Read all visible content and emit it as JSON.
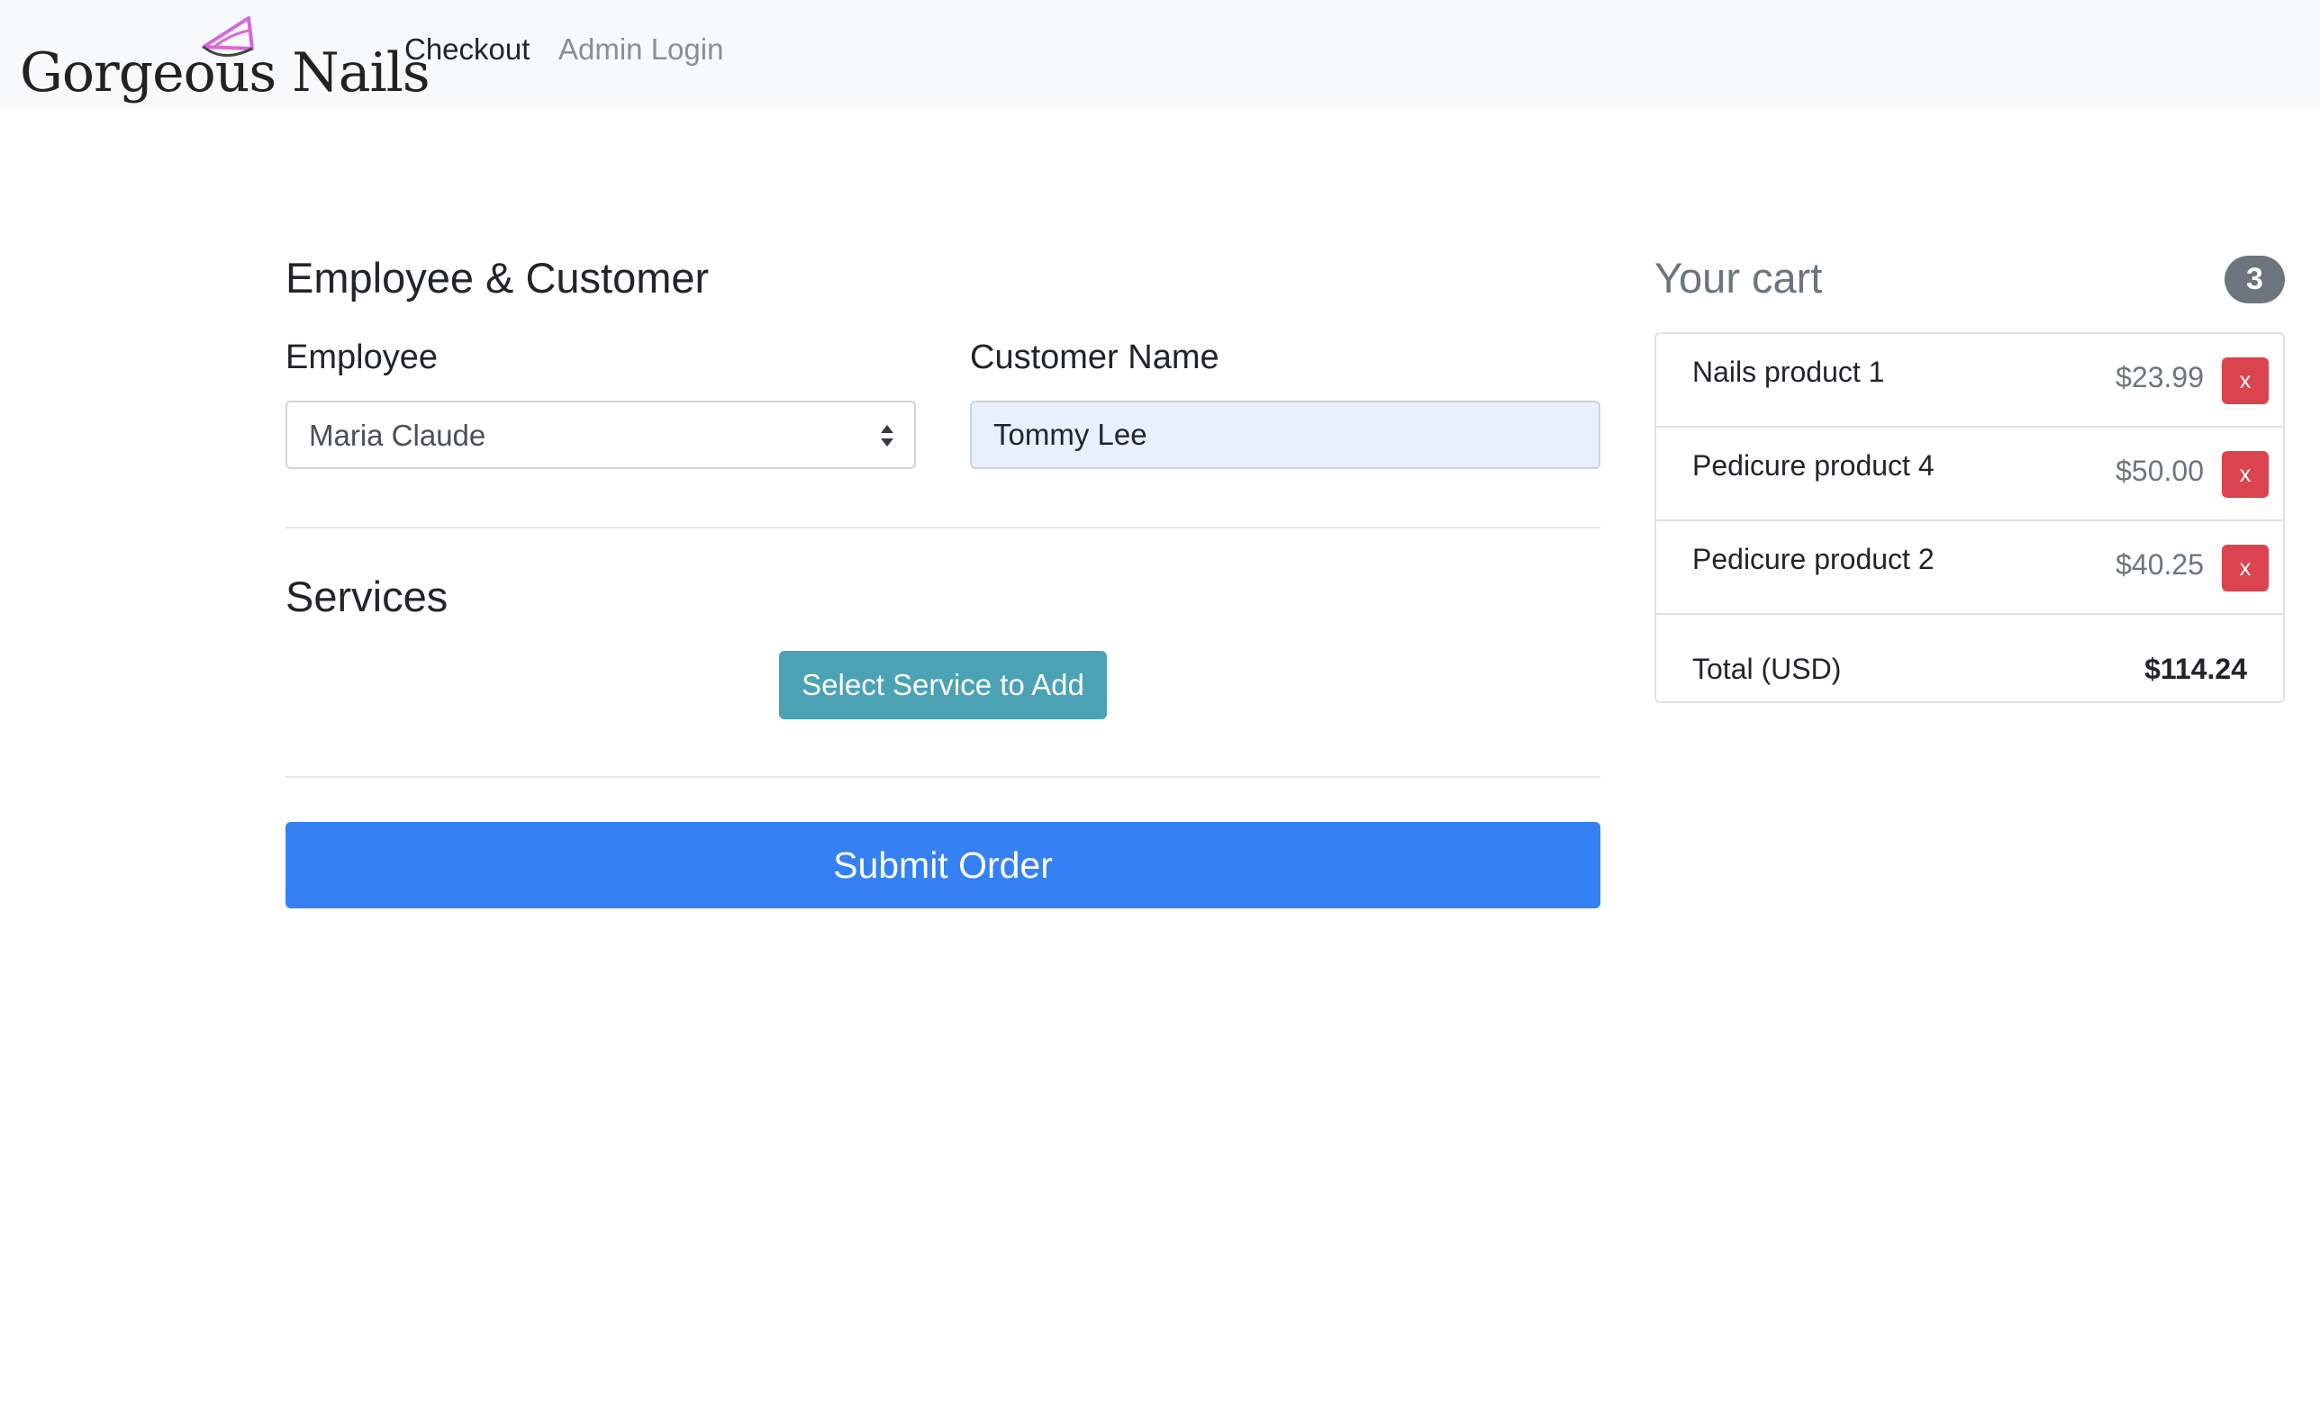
{
  "navbar": {
    "brand": "Gorgeous Nails",
    "brand_icon": "nail-polish-icon",
    "links": [
      {
        "label": "Checkout",
        "active": true
      },
      {
        "label": "Admin Login",
        "active": false
      }
    ]
  },
  "form": {
    "section_title": "Employee & Customer",
    "employee_label": "Employee",
    "employee_value": "Maria Claude",
    "customer_label": "Customer Name",
    "customer_value": "Tommy Lee",
    "services_title": "Services",
    "add_service_label": "Select Service to Add",
    "submit_label": "Submit Order"
  },
  "cart": {
    "title": "Your cart",
    "count": "3",
    "items": [
      {
        "name": "Nails product 1",
        "price": "$23.99",
        "remove_label": "x"
      },
      {
        "name": "Pedicure product 4",
        "price": "$50.00",
        "remove_label": "x"
      },
      {
        "name": "Pedicure product 2",
        "price": "$40.25",
        "remove_label": "x"
      }
    ],
    "total_label": "Total (USD)",
    "total_value": "$114.24"
  },
  "colors": {
    "primary": "#3581f3",
    "info": "#4aa2b4",
    "danger": "#d9444f",
    "secondary": "#6c757d",
    "navbar_bg": "#f8f9fa",
    "autofill_bg": "#e8f0fe"
  }
}
